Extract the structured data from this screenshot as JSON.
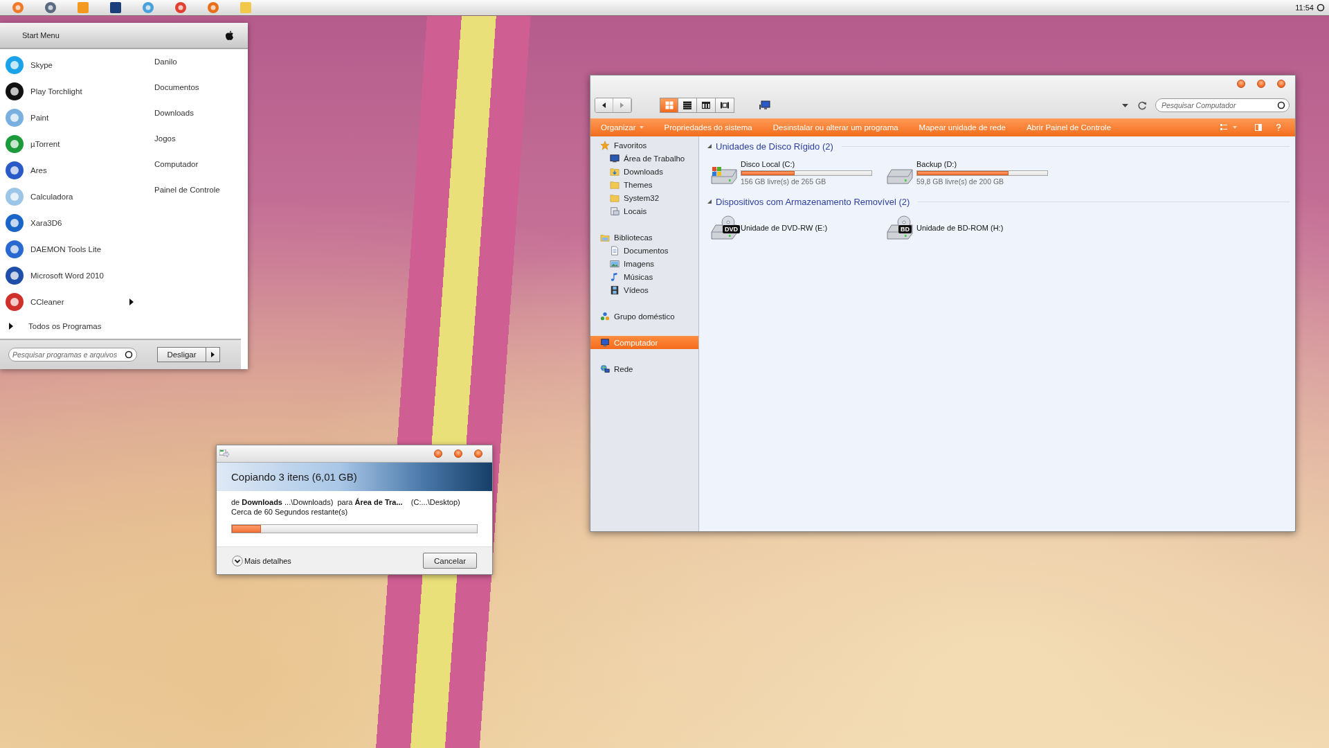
{
  "menu_bar": {
    "clock": "11:54"
  },
  "start_menu": {
    "title": "Start Menu",
    "programs": [
      {
        "label": "Skype",
        "submenu": false
      },
      {
        "label": "Play Torchlight",
        "submenu": false
      },
      {
        "label": "Paint",
        "submenu": false
      },
      {
        "label": "µTorrent",
        "submenu": false
      },
      {
        "label": "Ares",
        "submenu": false
      },
      {
        "label": "Calculadora",
        "submenu": false
      },
      {
        "label": "Xara3D6",
        "submenu": false
      },
      {
        "label": "DAEMON Tools Lite",
        "submenu": false
      },
      {
        "label": "Microsoft Word 2010",
        "submenu": false
      },
      {
        "label": "CCleaner",
        "submenu": true
      }
    ],
    "places": [
      "Danilo",
      "Documentos",
      "Downloads",
      "Jogos",
      "Computador",
      "Painel de Controle"
    ],
    "all_programs": "Todos os Programas",
    "search": {
      "placeholder": "Pesquisar programas e arquivos"
    },
    "shutdown": "Desligar"
  },
  "explorer": {
    "views": [
      {
        "selected": true
      },
      {
        "selected": false
      },
      {
        "selected": false
      },
      {
        "selected": false
      }
    ],
    "search": {
      "placeholder": "Pesquisar Computador"
    },
    "commands": [
      {
        "label": "Organizar",
        "dropdown": true
      },
      {
        "label": "Propriedades do sistema",
        "dropdown": false
      },
      {
        "label": "Desinstalar ou alterar um programa",
        "dropdown": false
      },
      {
        "label": "Mapear unidade de rede",
        "dropdown": false
      },
      {
        "label": "Abrir Painel de Controle",
        "dropdown": false
      }
    ],
    "navigation": [
      {
        "label": "Favoritos",
        "kind": "favorites",
        "selected": false,
        "children": [
          {
            "label": "Área de Trabalho",
            "kind": "desktop",
            "selected": false
          },
          {
            "label": "Downloads",
            "kind": "downloads",
            "selected": false
          },
          {
            "label": "Themes",
            "kind": "folder",
            "selected": false
          },
          {
            "label": "System32",
            "kind": "folder",
            "selected": false
          },
          {
            "label": "Locais",
            "kind": "recent",
            "selected": false
          }
        ]
      },
      {
        "label": "Bibliotecas",
        "kind": "libraries",
        "selected": false,
        "children": [
          {
            "label": "Documentos",
            "kind": "document",
            "selected": false
          },
          {
            "label": "Imagens",
            "kind": "pictures",
            "selected": false
          },
          {
            "label": "Músicas",
            "kind": "music",
            "selected": false
          },
          {
            "label": "Vídeos",
            "kind": "videos",
            "selected": false
          }
        ]
      },
      {
        "label": "Grupo doméstico",
        "kind": "homegroup",
        "selected": false
      },
      {
        "label": "Computador",
        "kind": "computer",
        "selected": true
      },
      {
        "label": "Rede",
        "kind": "network",
        "selected": false
      }
    ],
    "sections": [
      {
        "title": "Unidades de Disco Rígido (2)",
        "drives": [
          {
            "name": "Disco Local (C:)",
            "kind": "system",
            "level": 0.41,
            "free": "156 GB livre(s) de 265 GB"
          },
          {
            "name": "Backup (D:)",
            "kind": "disk",
            "level": 0.7,
            "free": "59,8 GB livre(s) de 200 GB"
          }
        ]
      },
      {
        "title": "Dispositivos com Armazenamento Removível (2)",
        "drives": [
          {
            "name": "Unidade de DVD-RW (E:)",
            "kind": "optical",
            "badge": "DVD"
          },
          {
            "name": "Unidade de BD-ROM (H:)",
            "kind": "optical",
            "badge": "BD"
          }
        ]
      }
    ]
  },
  "copy_dialog": {
    "title": "Copiando 3 itens (6,01 GB)",
    "route": "de **Downloads** ...\\Downloads)  para **Área de Tra...**    (C:...\\Desktop)",
    "remaining": "Cerca de 60 Segundos restante(s)",
    "level": 0.12,
    "details": "Mais detalhes",
    "cancel": "Cancelar"
  }
}
